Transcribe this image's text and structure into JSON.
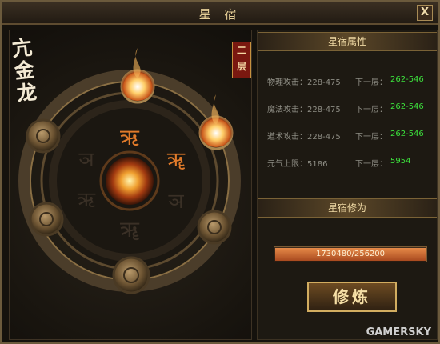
{
  "window": {
    "title": "星 宿",
    "close_label": "X"
  },
  "constellation": {
    "name": "亢金龙",
    "layer_label": "二层"
  },
  "attributes": {
    "header": "星宿属性",
    "next_label": "下一层：",
    "rows": [
      {
        "label": "物理攻击：228-475",
        "next": "262-546"
      },
      {
        "label": "魔法攻击：228-475",
        "next": "262-546"
      },
      {
        "label": "道术攻击：228-475",
        "next": "262-546"
      },
      {
        "label": "元气上限：5186",
        "next": "5954"
      }
    ]
  },
  "cultivation": {
    "header": "星宿修为",
    "progress_text": "1730480/256200",
    "progress_fraction": 1.0,
    "button_label": "修炼"
  },
  "watermark": "GAMERSKY",
  "colors": {
    "accent_gold": "#d2ad60",
    "next_value": "#3ce03c",
    "progress": "#e68a48"
  }
}
